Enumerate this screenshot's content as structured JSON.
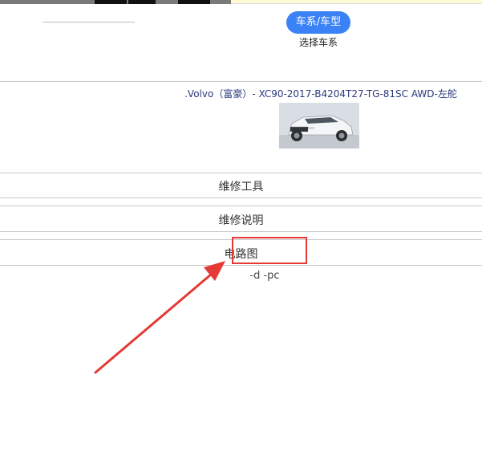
{
  "header": {
    "pill_label": "车系/车型",
    "pill_caption": "选择车系"
  },
  "vehicle": {
    "title": ".Volvo（富豪）- XC90-2017-B4204T27-TG-81SC AWD-左舵"
  },
  "menu": {
    "items": [
      {
        "label": "维修工具"
      },
      {
        "label": "维修说明"
      },
      {
        "label": "电路图"
      }
    ]
  },
  "footer": {
    "sub_text": "-d -pc"
  },
  "colors": {
    "accent": "#3b82f6",
    "highlight": "#e53935",
    "title_text": "#2a3a7a"
  }
}
